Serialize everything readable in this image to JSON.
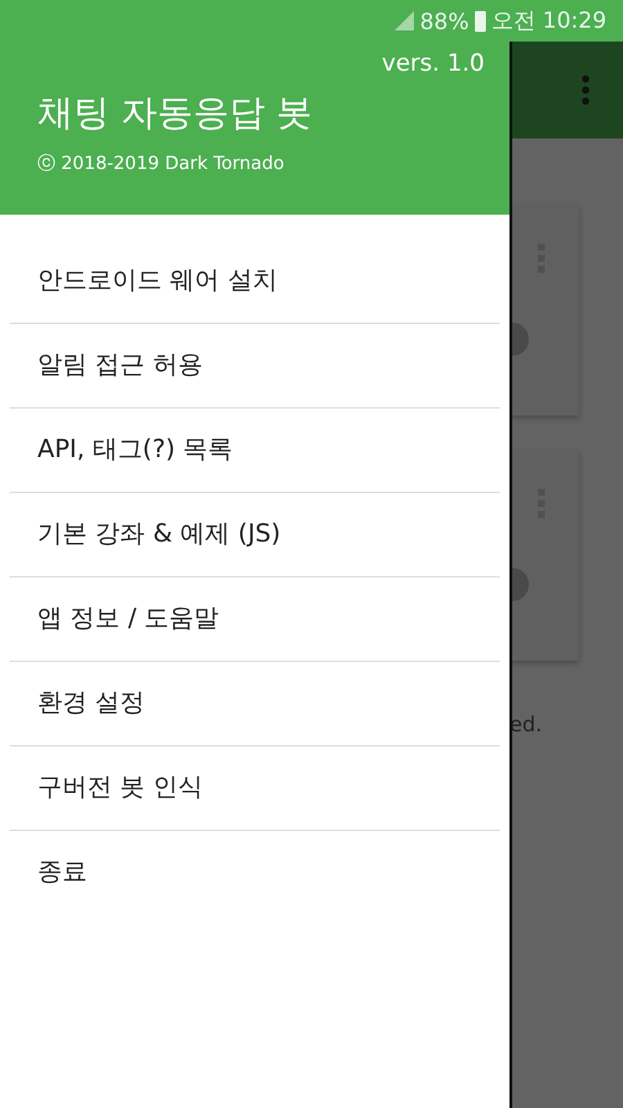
{
  "status_bar": {
    "battery": "88%",
    "time": "오전 10:29"
  },
  "drawer": {
    "version": "vers. 1.0",
    "title": "채팅 자동응답 봇",
    "copyright": "ⓒ 2018-2019 Dark Tornado",
    "items": [
      {
        "label": "안드로이드 웨어 설치"
      },
      {
        "label": "알림 접근 허용"
      },
      {
        "label": "API, 태그(?) 목록"
      },
      {
        "label": "기본 강좌 & 예제 (JS)"
      },
      {
        "label": "앱 정보 / 도움말"
      },
      {
        "label": "환경 설정"
      },
      {
        "label": "구버전 봇 인식"
      },
      {
        "label": "종료"
      }
    ]
  },
  "background": {
    "cards": [
      {
        "kind": "toggle-card"
      },
      {
        "kind": "toggle-card"
      }
    ],
    "text": "ed."
  }
}
